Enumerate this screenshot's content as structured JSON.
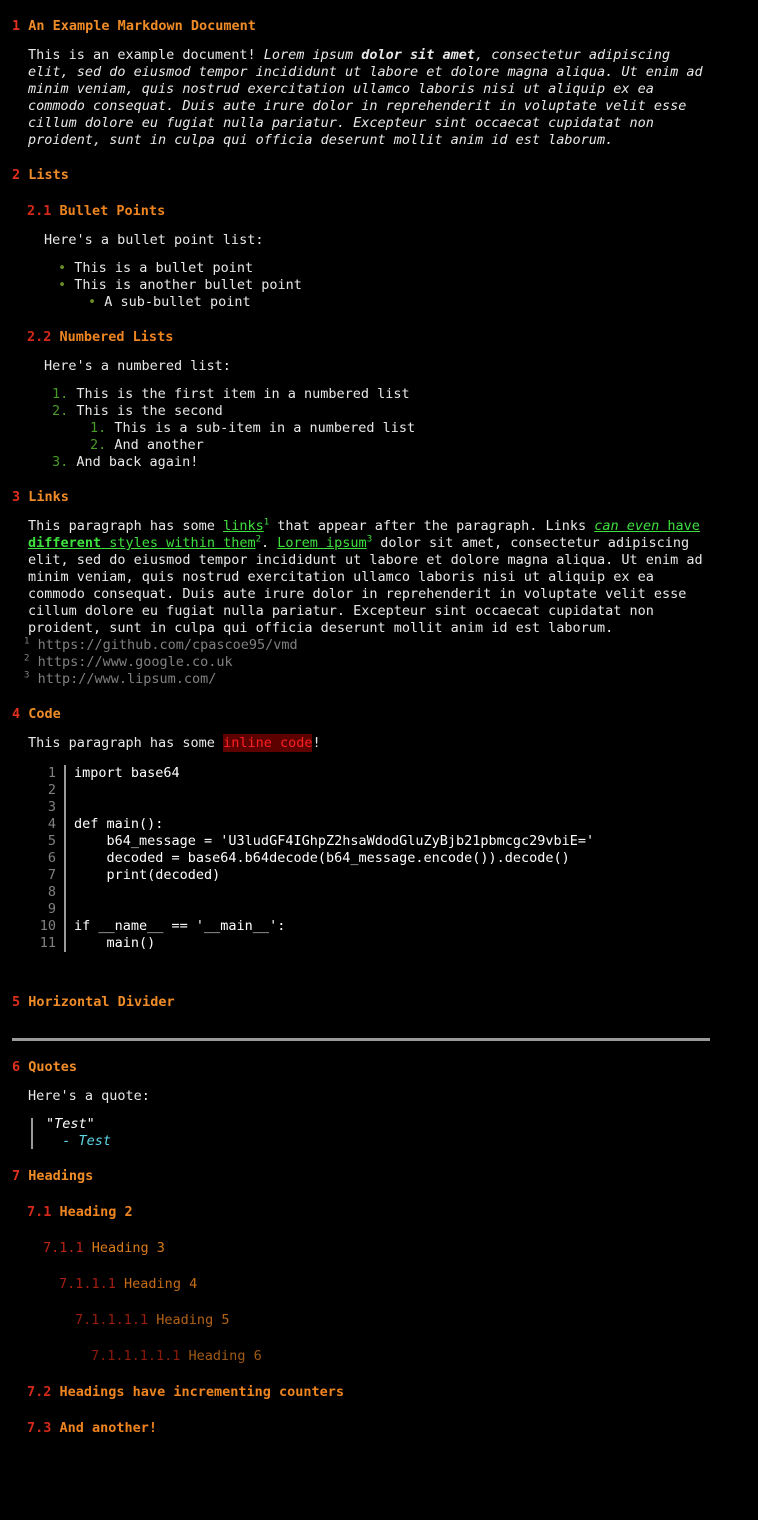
{
  "document": {
    "sections": [
      {
        "number": "1",
        "title": "An Example Markdown Document",
        "level": 1
      },
      {
        "number": "2",
        "title": "Lists",
        "level": 1
      },
      {
        "number": "2.1",
        "title": "Bullet Points",
        "level": 2
      },
      {
        "number": "2.2",
        "title": "Numbered Lists",
        "level": 2
      },
      {
        "number": "3",
        "title": "Links",
        "level": 1
      },
      {
        "number": "4",
        "title": "Code",
        "level": 1
      },
      {
        "number": "5",
        "title": "Horizontal Divider",
        "level": 1
      },
      {
        "number": "6",
        "title": "Quotes",
        "level": 1
      },
      {
        "number": "7",
        "title": "Headings",
        "level": 1
      },
      {
        "number": "7.1",
        "title": "Heading 2",
        "level": 2
      },
      {
        "number": "7.1.1",
        "title": "Heading 3",
        "level": 3
      },
      {
        "number": "7.1.1.1",
        "title": "Heading 4",
        "level": 4
      },
      {
        "number": "7.1.1.1.1",
        "title": "Heading 5",
        "level": 5
      },
      {
        "number": "7.1.1.1.1.1",
        "title": "Heading 6",
        "level": 6
      },
      {
        "number": "7.2",
        "title": "Headings have incrementing counters",
        "level": 2
      },
      {
        "number": "7.3",
        "title": "And another!",
        "level": 2
      }
    ],
    "intro_paragraph": {
      "plain_prefix": "This is an example document! ",
      "italic_1": "Lorem ipsum ",
      "bold_italic": "dolor sit amet",
      "italic_2": ", consectetur adipiscing elit, sed do eiusmod tempor incididunt ut labore et dolore magna aliqua. Ut enim ad minim veniam, quis nostrud exercitation ullamco laboris nisi ut aliquip ex ea commodo consequat. Duis aute irure dolor in reprehenderit in voluptate velit esse cillum dolore eu fugiat nulla pariatur. Excepteur sint occaecat cupidatat non proident, sunt in culpa qui officia deserunt mollit anim id est laborum."
    },
    "bullet_intro": "Here's a bullet point list:",
    "bullet_items": [
      {
        "marker": "•",
        "text": "This is a bullet point",
        "depth": 1
      },
      {
        "marker": "•",
        "text": "This is another bullet point",
        "depth": 1
      },
      {
        "marker": "•",
        "text": "A sub-bullet point",
        "depth": 2
      }
    ],
    "numbered_intro": "Here's a numbered list:",
    "numbered_items": [
      {
        "marker": "1.",
        "text": "This is the first item in a numbered list",
        "depth": 1
      },
      {
        "marker": "2.",
        "text": "This is the second",
        "depth": 1
      },
      {
        "marker": "1.",
        "text": "This is a sub-item in a numbered list",
        "depth": 2
      },
      {
        "marker": "2.",
        "text": "And another",
        "depth": 2
      },
      {
        "marker": "3.",
        "text": "And back again!",
        "depth": 1
      }
    ],
    "links_paragraph": {
      "p1": "This paragraph has some ",
      "link1_text": "links",
      "link1_sup": "1",
      "p2": " that appear after the paragraph. Links ",
      "link2_italic": "can even",
      "link2_plain_a": " have ",
      "link2_bold": "different",
      "link2_plain_b": " styles within them",
      "link2_sup": "2",
      "p3": ". ",
      "link3_text": "Lorem ipsum",
      "link3_sup": "3",
      "p4": " dolor sit amet, consectetur adipiscing elit, sed do eiusmod tempor incididunt ut labore et dolore magna aliqua. Ut enim ad minim veniam, quis nostrud exercitation ullamco laboris nisi ut aliquip ex ea commodo consequat. Duis aute irure dolor in reprehenderit in voluptate velit esse cillum dolore eu fugiat nulla pariatur. Excepteur sint occaecat cupidatat non proident, sunt in culpa qui officia deserunt mollit anim id est laborum."
    },
    "footnotes": [
      {
        "index": "1",
        "url": "https://github.com/cpascoe95/vmd"
      },
      {
        "index": "2",
        "url": "https://www.google.co.uk"
      },
      {
        "index": "3",
        "url": "http://www.lipsum.com/"
      }
    ],
    "code_paragraph": {
      "prefix": "This paragraph has some ",
      "inline_code": "inline code",
      "suffix": "!"
    },
    "code_block": {
      "language": "python",
      "lines": [
        {
          "n": "1",
          "src": "import base64"
        },
        {
          "n": "2",
          "src": ""
        },
        {
          "n": "3",
          "src": ""
        },
        {
          "n": "4",
          "src": "def main():"
        },
        {
          "n": "5",
          "src": "    b64_message = 'U3ludGF4IGhpZ2hsaWdodGluZyBjb21pbmcgc29vbiE='"
        },
        {
          "n": "6",
          "src": "    decoded = base64.b64decode(b64_message.encode()).decode()"
        },
        {
          "n": "7",
          "src": "    print(decoded)"
        },
        {
          "n": "8",
          "src": ""
        },
        {
          "n": "9",
          "src": ""
        },
        {
          "n": "10",
          "src": "if __name__ == '__main__':"
        },
        {
          "n": "11",
          "src": "    main()"
        }
      ]
    },
    "quote_intro": "Here's a quote:",
    "quote": {
      "text": "\"Test\"",
      "attribution": "  - Test"
    }
  },
  "colors": {
    "background": "#000000",
    "body_text": "#e8e8e8",
    "heading_number_h1": "#e0301e",
    "heading_text_h1": "#f08c28",
    "heading_number_h6": "#8b1a0a",
    "heading_text_h6": "#a05a14",
    "link": "#3ee03e",
    "bullet": "#6b8e23",
    "ordered_marker": "#4a9a28",
    "footnote": "#808080",
    "line_number": "#808080",
    "inline_code_bg": "#5c0000",
    "inline_code_fg": "#ff2020",
    "divider": "#9a9a9a",
    "quote_bar": "#9a9a9a",
    "quote_attribution": "#5fd7e7"
  }
}
